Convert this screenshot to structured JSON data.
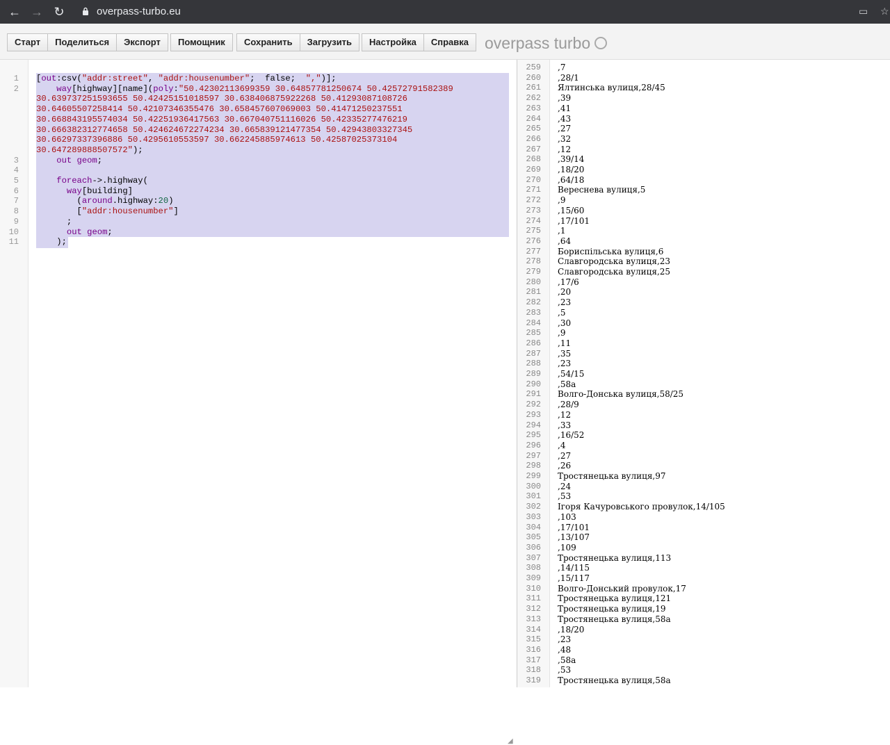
{
  "browser": {
    "url": "overpass-turbo.eu"
  },
  "toolbar": {
    "groups": [
      [
        "Старт",
        "Поделиться",
        "Экспорт"
      ],
      [
        "Помощник"
      ],
      [
        "Сохранить",
        "Загрузить"
      ],
      [
        "Настройка",
        "Справка"
      ]
    ],
    "brand": "overpass turbo"
  },
  "editor": {
    "lines": [
      {
        "n": "1",
        "segs": [
          [
            "",
            "["
          ],
          [
            "kw",
            "out"
          ],
          [
            "",
            ":csv("
          ],
          [
            "str",
            "\"addr:street\""
          ],
          [
            "",
            ", "
          ],
          [
            "str",
            "\"addr:housenumber\""
          ],
          [
            "",
            ";  false;  "
          ],
          [
            "str",
            "\",\""
          ],
          [
            "",
            ")];"
          ]
        ]
      },
      {
        "n": "2",
        "segs": [
          [
            "",
            "    "
          ],
          [
            "kw",
            "way"
          ],
          [
            "",
            "[highway][name]("
          ],
          [
            "kw",
            "poly"
          ],
          [
            "",
            ":"
          ],
          [
            "str",
            "\"50.42302113699359 30.64857781250674 50.42572791582389"
          ]
        ]
      },
      {
        "n": "",
        "segs": [
          [
            "str",
            "30.639737251593655 50.42425151018597 30.638406875922268 50.41293087108726"
          ]
        ]
      },
      {
        "n": "",
        "segs": [
          [
            "str",
            "30.64605507258414 50.42107346355476 30.658457607069003 50.41471250237551"
          ]
        ]
      },
      {
        "n": "",
        "segs": [
          [
            "str",
            "30.668843195574034 50.42251936417563 30.667040751116026 50.42335277476219"
          ]
        ]
      },
      {
        "n": "",
        "segs": [
          [
            "str",
            "30.666382312774658 50.424624672274234 30.665839121477354 50.42943803327345"
          ]
        ]
      },
      {
        "n": "",
        "segs": [
          [
            "str",
            "30.66297337396886 50.4295610553597 30.662245885974613 50.42587025373104"
          ]
        ]
      },
      {
        "n": "",
        "segs": [
          [
            "str",
            "30.647289888507572\""
          ],
          [
            "",
            ");"
          ]
        ]
      },
      {
        "n": "3",
        "segs": [
          [
            "",
            "    "
          ],
          [
            "kw",
            "out geom"
          ],
          [
            "",
            ";"
          ]
        ]
      },
      {
        "n": "4",
        "segs": [
          [
            "",
            ""
          ]
        ]
      },
      {
        "n": "5",
        "segs": [
          [
            "",
            "    "
          ],
          [
            "kw",
            "foreach"
          ],
          [
            "",
            "->.highway("
          ]
        ]
      },
      {
        "n": "6",
        "segs": [
          [
            "",
            "      "
          ],
          [
            "kw",
            "way"
          ],
          [
            "",
            "[building]"
          ]
        ]
      },
      {
        "n": "7",
        "segs": [
          [
            "",
            "        ("
          ],
          [
            "kw",
            "around"
          ],
          [
            "",
            ".highway:"
          ],
          [
            "num",
            "20"
          ],
          [
            "",
            ")"
          ]
        ]
      },
      {
        "n": "8",
        "segs": [
          [
            "",
            "        ["
          ],
          [
            "str",
            "\"addr:housenumber\""
          ],
          [
            "",
            "]"
          ]
        ]
      },
      {
        "n": "9",
        "segs": [
          [
            "",
            "      ;"
          ]
        ]
      },
      {
        "n": "10",
        "segs": [
          [
            "",
            "      "
          ],
          [
            "kw",
            "out geom"
          ],
          [
            "",
            ";"
          ]
        ]
      },
      {
        "n": "11",
        "segs": [
          [
            "",
            "    );"
          ]
        ]
      }
    ]
  },
  "result": {
    "rows": [
      {
        "n": "259",
        "t": ",7"
      },
      {
        "n": "260",
        "t": ",28/1"
      },
      {
        "n": "261",
        "t": "Ялтинська вулиця,28/45"
      },
      {
        "n": "262",
        "t": ",39"
      },
      {
        "n": "263",
        "t": ",41"
      },
      {
        "n": "264",
        "t": ",43"
      },
      {
        "n": "265",
        "t": ",27"
      },
      {
        "n": "266",
        "t": ",32"
      },
      {
        "n": "267",
        "t": ",12"
      },
      {
        "n": "268",
        "t": ",39/14"
      },
      {
        "n": "269",
        "t": ",18/20"
      },
      {
        "n": "270",
        "t": ",64/18"
      },
      {
        "n": "271",
        "t": "Вереснева вулиця,5"
      },
      {
        "n": "272",
        "t": ",9"
      },
      {
        "n": "273",
        "t": ",15/60"
      },
      {
        "n": "274",
        "t": ",17/101"
      },
      {
        "n": "275",
        "t": ",1"
      },
      {
        "n": "276",
        "t": ",64"
      },
      {
        "n": "277",
        "t": "Бориспільська вулиця,6"
      },
      {
        "n": "278",
        "t": "Славгородська вулиця,23"
      },
      {
        "n": "279",
        "t": "Славгородська вулиця,25"
      },
      {
        "n": "280",
        "t": ",17/6"
      },
      {
        "n": "281",
        "t": ",20"
      },
      {
        "n": "282",
        "t": ",23"
      },
      {
        "n": "283",
        "t": ",5"
      },
      {
        "n": "284",
        "t": ",30"
      },
      {
        "n": "285",
        "t": ",9"
      },
      {
        "n": "286",
        "t": ",11"
      },
      {
        "n": "287",
        "t": ",35"
      },
      {
        "n": "288",
        "t": ",23"
      },
      {
        "n": "289",
        "t": ",54/15"
      },
      {
        "n": "290",
        "t": ",58а"
      },
      {
        "n": "291",
        "t": "Волго-Донська вулиця,58/25"
      },
      {
        "n": "292",
        "t": ",28/9"
      },
      {
        "n": "293",
        "t": ",12"
      },
      {
        "n": "294",
        "t": ",33"
      },
      {
        "n": "295",
        "t": ",16/52"
      },
      {
        "n": "296",
        "t": ",4"
      },
      {
        "n": "297",
        "t": ",27"
      },
      {
        "n": "298",
        "t": ",26"
      },
      {
        "n": "299",
        "t": "Тростянецька вулиця,97"
      },
      {
        "n": "300",
        "t": ",24"
      },
      {
        "n": "301",
        "t": ",53"
      },
      {
        "n": "302",
        "t": "Ігоря Качуровського провулок,14/105"
      },
      {
        "n": "303",
        "t": ",103"
      },
      {
        "n": "304",
        "t": ",17/101"
      },
      {
        "n": "305",
        "t": ",13/107"
      },
      {
        "n": "306",
        "t": ",109"
      },
      {
        "n": "307",
        "t": "Тростянецька вулиця,113"
      },
      {
        "n": "308",
        "t": ",14/115"
      },
      {
        "n": "309",
        "t": ",15/117"
      },
      {
        "n": "310",
        "t": "Волго-Донський провулок,17"
      },
      {
        "n": "311",
        "t": "Тростянецька вулиця,121"
      },
      {
        "n": "312",
        "t": "Тростянецька вулиця,19"
      },
      {
        "n": "313",
        "t": "Тростянецька вулиця,58а"
      },
      {
        "n": "314",
        "t": ",18/20"
      },
      {
        "n": "315",
        "t": ",23"
      },
      {
        "n": "316",
        "t": ",48"
      },
      {
        "n": "317",
        "t": ",58а"
      },
      {
        "n": "318",
        "t": ",53"
      },
      {
        "n": "319",
        "t": "Тростянецька вулиця,58а"
      }
    ]
  }
}
